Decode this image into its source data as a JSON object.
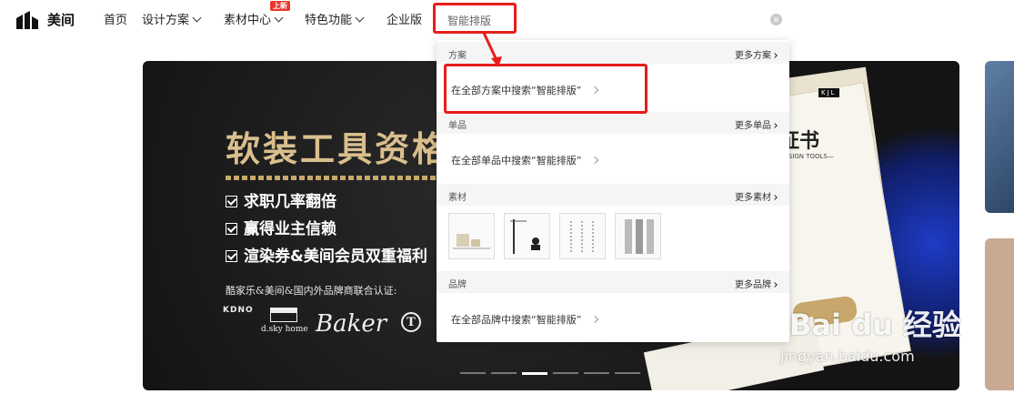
{
  "nav": {
    "brand": "美间",
    "items": [
      {
        "label": "首页"
      },
      {
        "label": "设计方案"
      },
      {
        "label": "素材中心"
      },
      {
        "label": "特色功能"
      },
      {
        "label": "企业版"
      }
    ],
    "new_badge": "上新"
  },
  "search": {
    "value": "智能排版"
  },
  "dropdown": {
    "sections": [
      {
        "label": "方案",
        "more": "更多方案",
        "row": "在全部方案中搜索“智能排版”"
      },
      {
        "label": "单品",
        "more": "更多单品",
        "row": "在全部单品中搜索“智能排版”"
      },
      {
        "label": "素材",
        "more": "更多素材"
      },
      {
        "label": "品牌",
        "more": "更多品牌",
        "row": "在全部品牌中搜索“智能排版”"
      }
    ]
  },
  "banner": {
    "title": "软装工具资格",
    "perks": [
      "求职几率翻倍",
      "赢得业主信赖",
      "渲染券&美间会员双重福利"
    ],
    "certify": "酷家乐&美间&国内外品牌商联合认证:",
    "partners": [
      "KDNO",
      "d.sky home",
      "Baker",
      "T"
    ],
    "cert_title": "证书",
    "cert_sub": "DESIGN TOOLS—",
    "cert_badge": "KJL",
    "dots_total": 6,
    "dots_active": 3
  },
  "watermark": {
    "text": "Bai du 经验",
    "url": "jingyan.baidu.com"
  },
  "colors": {
    "annotation": "#e81c1c",
    "gold": "#d9bf8d",
    "badge": "#e8382c"
  }
}
